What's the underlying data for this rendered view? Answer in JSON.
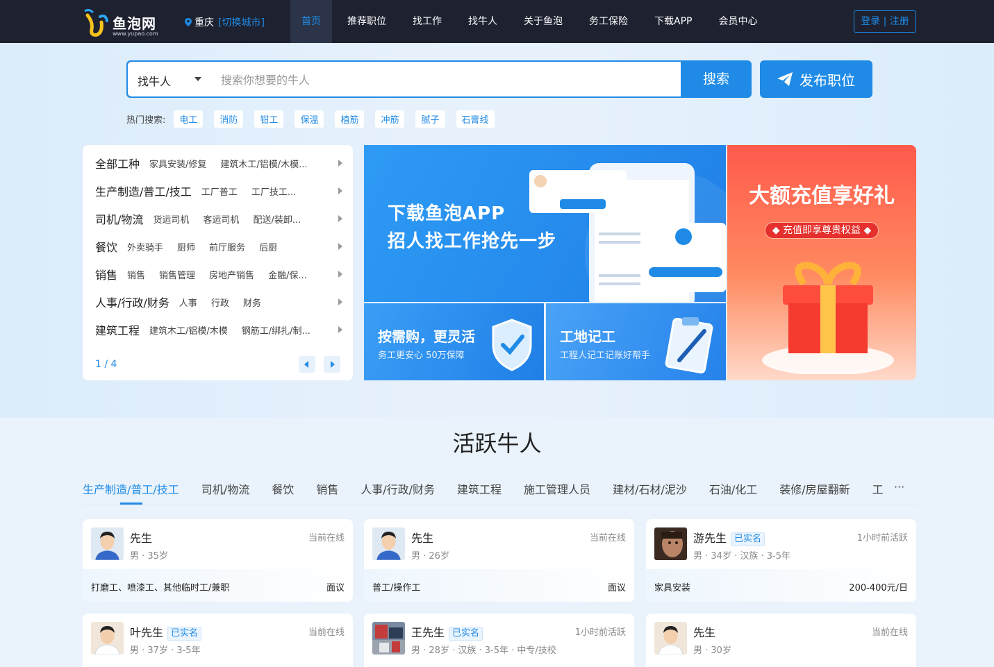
{
  "header": {
    "logo_text": "鱼泡网",
    "logo_sub": "www.yupao.com",
    "city": "重庆",
    "switch_city": "[切换城市]",
    "nav": [
      "首页",
      "推荐职位",
      "找工作",
      "找牛人",
      "关于鱼泡",
      "务工保险",
      "下载APP",
      "会员中心"
    ],
    "login": "登录 | 注册"
  },
  "search": {
    "type": "找牛人",
    "placeholder": "搜索你想要的牛人",
    "button": "搜索",
    "post_button": "发布职位"
  },
  "hot": {
    "label": "热门搜索:",
    "tags": [
      "电工",
      "消防",
      "钳工",
      "保温",
      "植筋",
      "冲筋",
      "腻子",
      "石膏线"
    ]
  },
  "categories": {
    "rows": [
      {
        "main": "全部工种",
        "subs": [
          "家具安装/修复",
          "建筑木工/铝模/木模..."
        ]
      },
      {
        "main": "生产制造/普工/技工",
        "subs": [
          "工厂普工",
          "工厂技工..."
        ]
      },
      {
        "main": "司机/物流",
        "subs": [
          "货运司机",
          "客运司机",
          "配送/装卸..."
        ]
      },
      {
        "main": "餐饮",
        "subs": [
          "外卖骑手",
          "厨师",
          "前厅服务",
          "后厨"
        ]
      },
      {
        "main": "销售",
        "subs": [
          "销售",
          "销售管理",
          "房地产销售",
          "金融/保..."
        ]
      },
      {
        "main": "人事/行政/财务",
        "subs": [
          "人事",
          "行政",
          "财务"
        ]
      },
      {
        "main": "建筑工程",
        "subs": [
          "建筑木工/铝模/木模",
          "钢筋工/绑扎/制..."
        ]
      }
    ],
    "pager": "1 / 4"
  },
  "banners": {
    "app": {
      "line1": "下载鱼泡APP",
      "line2": "招人找工作抢先一步"
    },
    "insurance": {
      "title": "按需购，更灵活",
      "sub": "务工更安心 50万保障"
    },
    "record": {
      "title": "工地记工",
      "sub": "工程人记工记账好帮手"
    },
    "promo": {
      "title": "大额充值享好礼",
      "pill": "◆ 充值即享尊贵权益 ◆"
    }
  },
  "section_title": "活跃牛人",
  "tabs": [
    "生产制造/普工/技工",
    "司机/物流",
    "餐饮",
    "销售",
    "人事/行政/财务",
    "建筑工程",
    "施工管理人员",
    "建材/石材/泥沙",
    "石油/化工",
    "装修/房屋翻新",
    "工"
  ],
  "tabs_more": "···",
  "workers": [
    {
      "name": "先生",
      "verified": "",
      "status": "当前在线",
      "info": "男 · 35岁",
      "job": "打磨工、喷漆工、其他临时工/兼职",
      "pay": "面议",
      "avatar": "cartoon"
    },
    {
      "name": "先生",
      "verified": "",
      "status": "当前在线",
      "info": "男 · 26岁",
      "job": "普工/操作工",
      "pay": "面议",
      "avatar": "cartoon"
    },
    {
      "name": "游先生",
      "verified": "已实名",
      "status": "1小时前活跃",
      "info": "男 · 34岁 · 汉族 · 3-5年",
      "job": "家具安装",
      "pay": "200-400元/日",
      "avatar": "photo-face"
    },
    {
      "name": "叶先生",
      "verified": "已实名",
      "status": "当前在线",
      "info": "男 · 37岁 · 3-5年",
      "job": "",
      "pay": "",
      "avatar": "cartoon-white"
    },
    {
      "name": "王先生",
      "verified": "已实名",
      "status": "1小时前活跃",
      "info": "男 · 28岁 · 汉族 · 3-5年 · 中专/技校",
      "job": "",
      "pay": "",
      "avatar": "photo-scene"
    },
    {
      "name": "先生",
      "verified": "",
      "status": "当前在线",
      "info": "男 · 30岁",
      "job": "",
      "pay": "",
      "avatar": "cartoon-white"
    }
  ]
}
